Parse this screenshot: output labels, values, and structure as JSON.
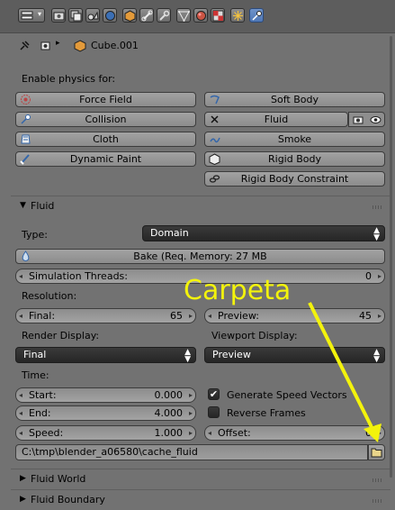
{
  "context": {
    "object_name": "Cube.001"
  },
  "physics": {
    "section_label": "Enable physics for:",
    "left": [
      "Force Field",
      "Collision",
      "Cloth",
      "Dynamic Paint"
    ],
    "right": [
      "Soft Body",
      "Fluid",
      "Smoke",
      "Rigid Body",
      "Rigid Body Constraint"
    ]
  },
  "fluid_panel": {
    "title": "Fluid",
    "type_label": "Type:",
    "type_value": "Domain",
    "bake_label": "Bake (Req. Memory: 27 MB",
    "sim_threads_label": "Simulation Threads:",
    "sim_threads_value": "0",
    "resolution_label": "Resolution:",
    "final_label": "Final:",
    "final_value": "65",
    "preview_label": "Preview:",
    "preview_value": "45",
    "render_display_label": "Render Display:",
    "render_display_value": "Final",
    "viewport_display_label": "Viewport Display:",
    "viewport_display_value": "Preview",
    "time_label": "Time:",
    "start_label": "Start:",
    "start_value": "0.000",
    "end_label": "End:",
    "end_value": "4.000",
    "speed_label": "Speed:",
    "speed_value": "1.000",
    "offset_label": "Offset:",
    "offset_value": "0",
    "generate_speed_vectors": {
      "label": "Generate Speed Vectors",
      "checked": true
    },
    "reverse_frames": {
      "label": "Reverse Frames",
      "checked": false
    },
    "cache_path": "C:\\tmp\\blender_a06580\\cache_fluid"
  },
  "collapsed_panels": [
    "Fluid World",
    "Fluid Boundary"
  ],
  "annotation": {
    "text": "Carpeta",
    "color": "#f3f30c"
  },
  "colors": {
    "background": "#727272",
    "header": "#5d5d5d",
    "active_tab": "#5b84c4",
    "dropdown": "#2e2e2e"
  }
}
